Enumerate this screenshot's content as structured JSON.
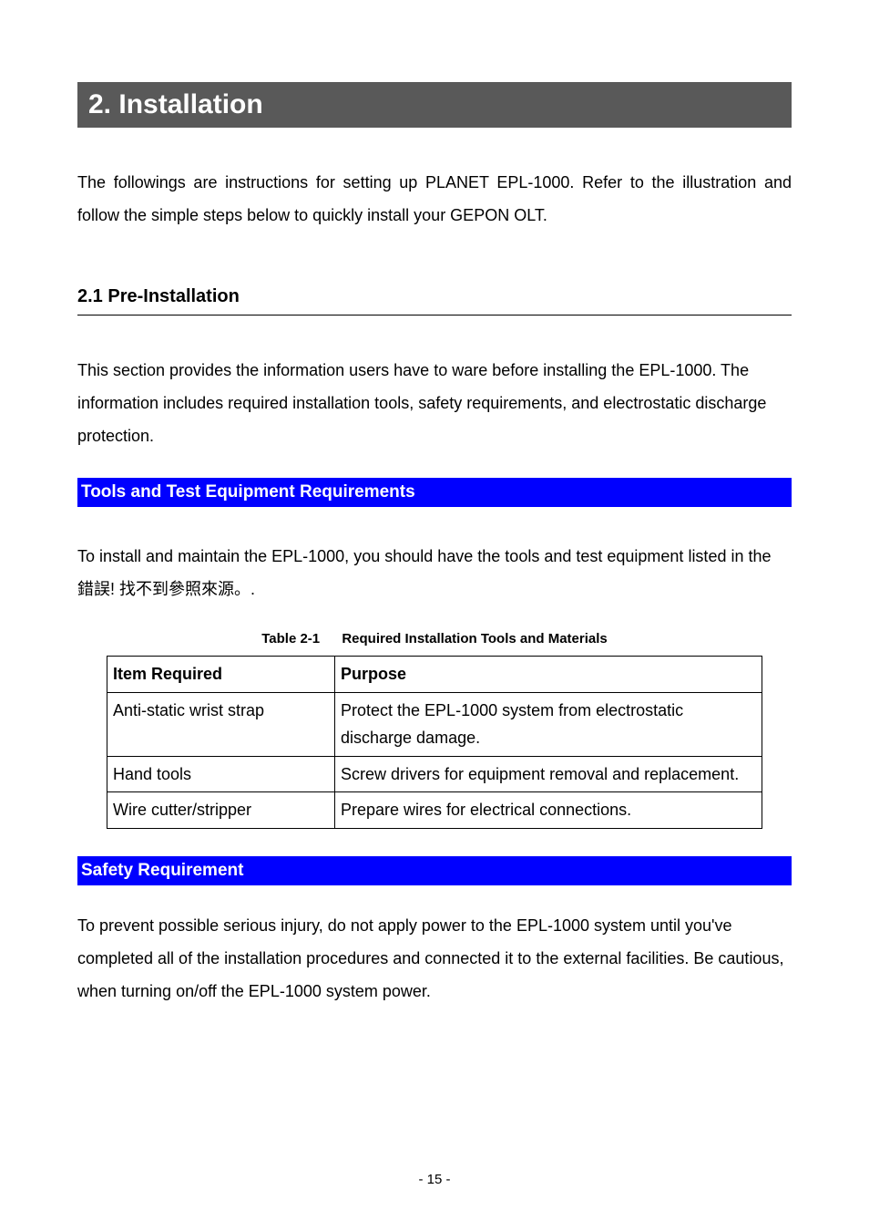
{
  "chapter": {
    "title": "2. Installation"
  },
  "intro": "The followings are instructions for setting up PLANET EPL-1000. Refer to the illustration and follow the simple steps below to quickly install your GEPON OLT.",
  "section_2_1": {
    "title": "2.1 Pre-Installation",
    "para": "This section provides the information users have to ware before installing the EPL-1000. The information includes required installation tools, safety requirements, and electrostatic discharge protection."
  },
  "tools_section": {
    "title": "Tools and Test Equipment Requirements",
    "para": "To install and maintain the EPL-1000, you should have the tools and test equipment listed in the 錯誤! 找不到參照來源。."
  },
  "table_2_1": {
    "caption_label": "Table   2-1",
    "caption_text": "Required Installation Tools and Materials",
    "headers": {
      "item": "Item Required",
      "purpose": "Purpose"
    },
    "rows": [
      {
        "item": "Anti-static wrist strap",
        "purpose": "Protect the EPL-1000 system from electrostatic discharge damage."
      },
      {
        "item": "Hand tools",
        "purpose": "Screw drivers for equipment removal and replacement."
      },
      {
        "item": "Wire cutter/stripper",
        "purpose": "Prepare wires for electrical connections."
      }
    ]
  },
  "safety_section": {
    "title": "Safety Requirement",
    "para": "To prevent possible serious injury, do not apply power to the EPL-1000 system until you've completed all of the installation procedures and connected it to the external facilities. Be cautious, when turning on/off the EPL-1000 system power."
  },
  "page_number": "- 15 -"
}
